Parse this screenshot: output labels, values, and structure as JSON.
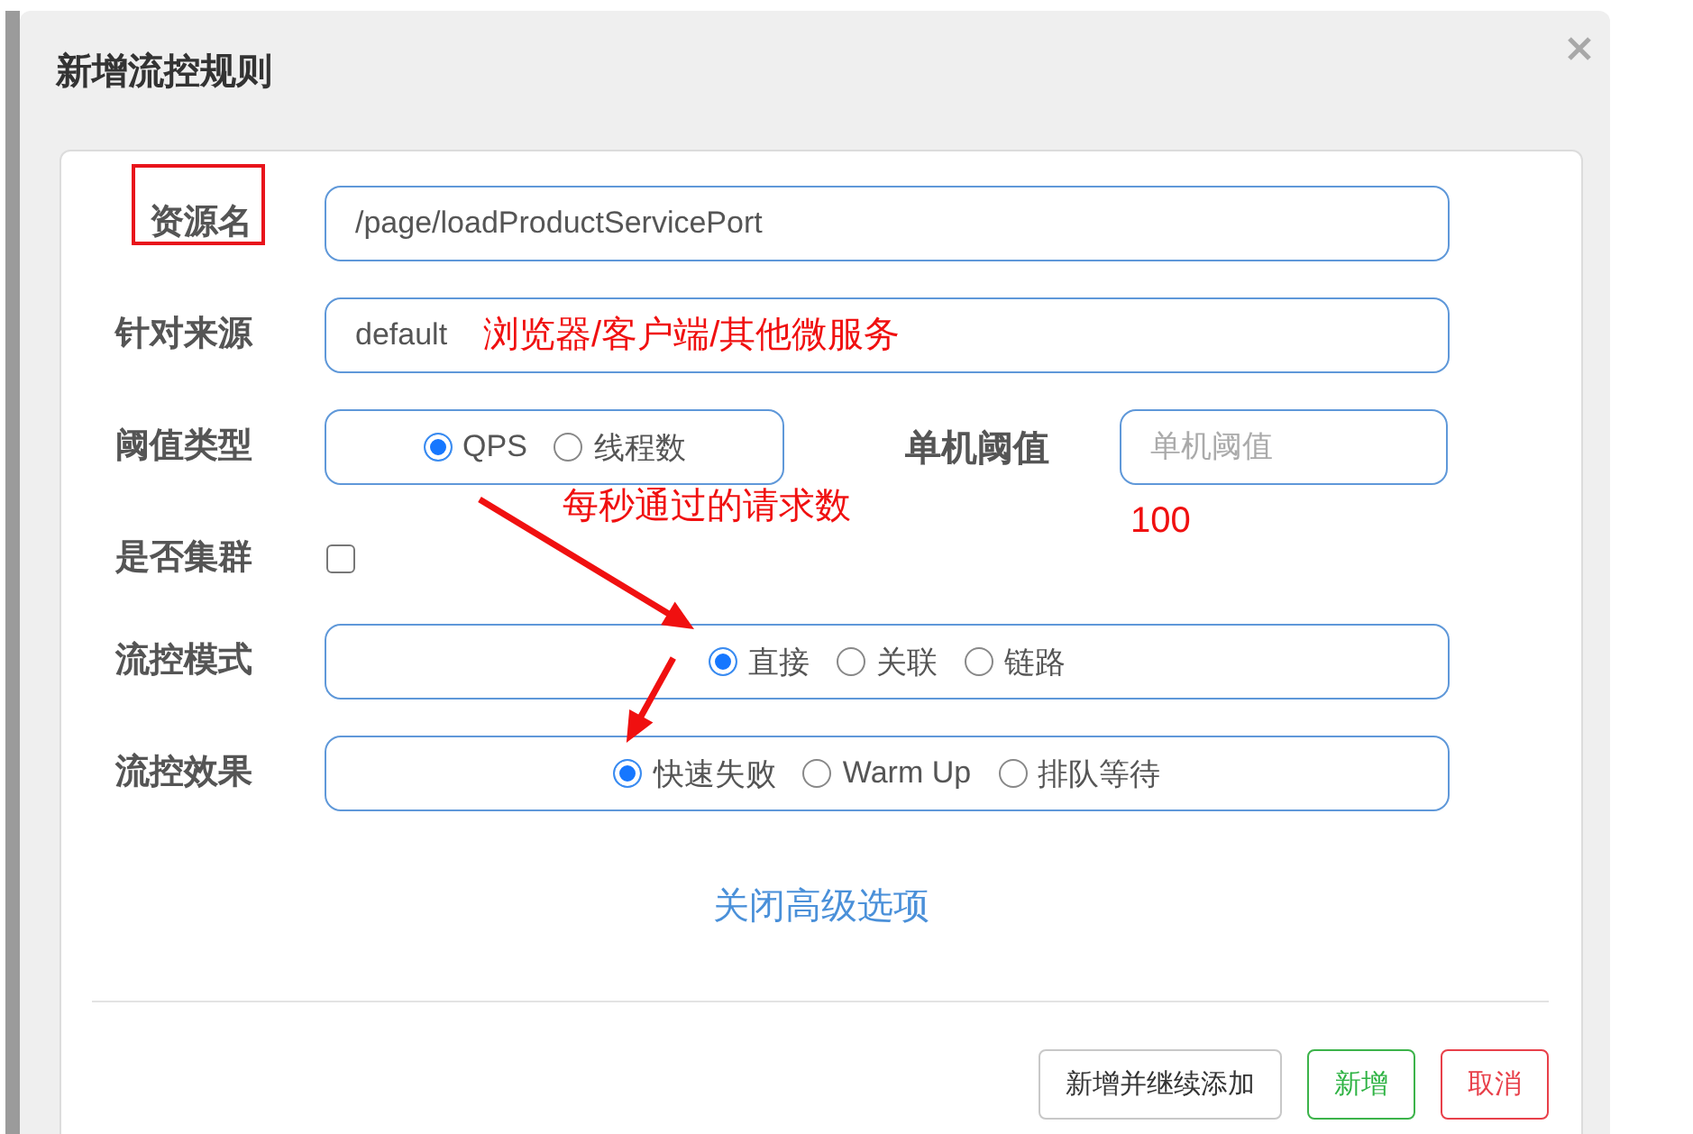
{
  "dialog": {
    "title": "新增流控规则"
  },
  "rows": [
    {
      "kind": "input",
      "label": "资源名",
      "highlighted": true,
      "value": "/page/loadProductServicePort"
    },
    {
      "kind": "input",
      "label": "针对来源",
      "highlighted": false,
      "value": "default",
      "note": "浏览器/客户端/其他微服务"
    },
    {
      "kind": "radio",
      "label": "阈值类型",
      "highlighted": false,
      "options": [
        {
          "label": "QPS",
          "selected": true,
          "arrow": false
        },
        {
          "label": "线程数",
          "selected": false,
          "arrow": false
        }
      ],
      "note": "每秒通过的请求数",
      "side_field": {
        "label": "单机阈值",
        "placeholder": "单机阈值",
        "note": "100"
      }
    },
    {
      "kind": "checkbox",
      "label": "是否集群",
      "highlighted": false,
      "checked": false
    },
    {
      "kind": "radio",
      "label": "流控模式",
      "highlighted": false,
      "options": [
        {
          "label": "直接",
          "selected": true,
          "arrow": true
        },
        {
          "label": "关联",
          "selected": false,
          "arrow": false
        },
        {
          "label": "链路",
          "selected": false,
          "arrow": false
        }
      ]
    },
    {
      "kind": "radio",
      "label": "流控效果",
      "highlighted": false,
      "options": [
        {
          "label": "快速失败",
          "selected": true,
          "arrow": true
        },
        {
          "label": "Warm Up",
          "selected": false,
          "arrow": false
        },
        {
          "label": "排队等待",
          "selected": false,
          "arrow": false
        }
      ]
    }
  ],
  "advanced_link": "关闭高级选项",
  "buttons": [
    {
      "label": "新增并继续添加",
      "kind": "default"
    },
    {
      "label": "新增",
      "kind": "confirm"
    },
    {
      "label": "取消",
      "kind": "cancel"
    }
  ]
}
